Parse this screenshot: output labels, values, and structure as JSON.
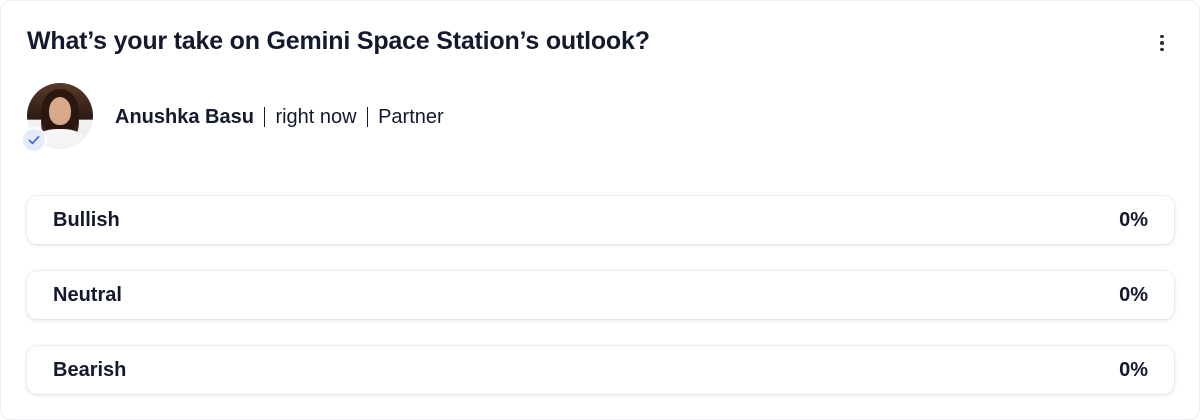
{
  "post": {
    "title": "What’s your take on Gemini Space Station’s outlook?",
    "menu_icon": "more-vertical-icon"
  },
  "author": {
    "name": "Anushka Basu",
    "time": "right now",
    "role": "Partner",
    "verified": true,
    "verified_icon": "checkmark-icon"
  },
  "poll": {
    "options": [
      {
        "label": "Bullish",
        "percent": "0%"
      },
      {
        "label": "Neutral",
        "percent": "0%"
      },
      {
        "label": "Bearish",
        "percent": "0%"
      }
    ]
  },
  "colors": {
    "text": "#141a2e",
    "verified_bg": "#e4ecfb",
    "verified_check": "#3b6fe0"
  }
}
